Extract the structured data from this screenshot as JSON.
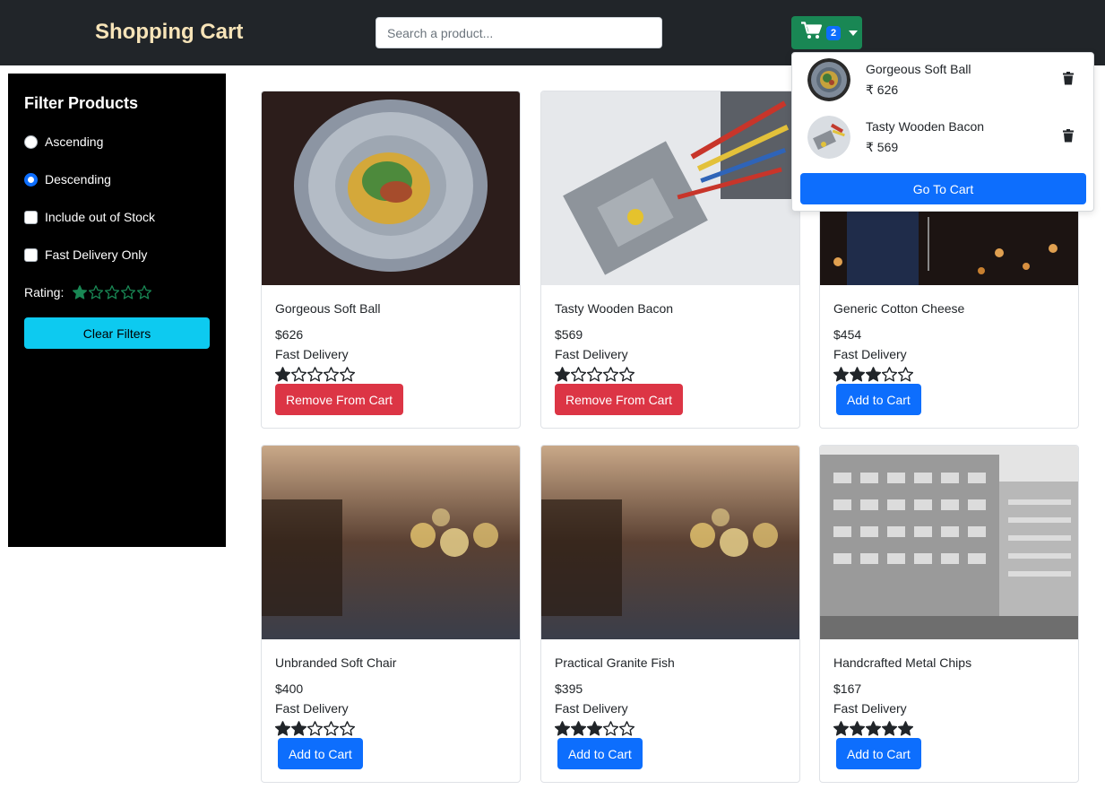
{
  "header": {
    "brand": "Shopping Cart",
    "search_placeholder": "Search a product...",
    "cart_count": "2"
  },
  "cart_dropdown": {
    "items": [
      {
        "name": "Gorgeous Soft Ball",
        "price": "₹ 626"
      },
      {
        "name": "Tasty Wooden Bacon",
        "price": "₹ 569"
      }
    ],
    "go_to_cart_label": "Go To Cart"
  },
  "filters": {
    "title": "Filter Products",
    "ascending_label": "Ascending",
    "descending_label": "Descending",
    "out_of_stock_label": "Include out of Stock",
    "fast_delivery_label": "Fast Delivery Only",
    "rating_label": "Rating:",
    "rating_value": 1,
    "clear_label": "Clear Filters",
    "sort_selected": "Descending"
  },
  "products": [
    {
      "name": "Gorgeous Soft Ball",
      "price": "$626",
      "delivery": "Fast Delivery",
      "rating": 1,
      "button": "Remove From Cart",
      "in_cart": true
    },
    {
      "name": "Tasty Wooden Bacon",
      "price": "$569",
      "delivery": "Fast Delivery",
      "rating": 1,
      "button": "Remove From Cart",
      "in_cart": true
    },
    {
      "name": "Generic Cotton Cheese",
      "price": "$454",
      "delivery": "Fast Delivery",
      "rating": 3,
      "button": "Add to Cart",
      "in_cart": false
    },
    {
      "name": "Unbranded Soft Chair",
      "price": "$400",
      "delivery": "Fast Delivery",
      "rating": 2,
      "button": "Add to Cart",
      "in_cart": false
    },
    {
      "name": "Practical Granite Fish",
      "price": "$395",
      "delivery": "Fast Delivery",
      "rating": 3,
      "button": "Add to Cart",
      "in_cart": false
    },
    {
      "name": "Handcrafted Metal Chips",
      "price": "$167",
      "delivery": "Fast Delivery",
      "rating": 5,
      "button": "Add to Cart",
      "in_cart": false
    }
  ],
  "colors": {
    "navbar": "#212529",
    "brand": "#f7e4b8",
    "cart_button": "#198754",
    "primary": "#0d6efd",
    "danger": "#dc3545",
    "info": "#0dcaf0",
    "star_filter": "#198754"
  }
}
